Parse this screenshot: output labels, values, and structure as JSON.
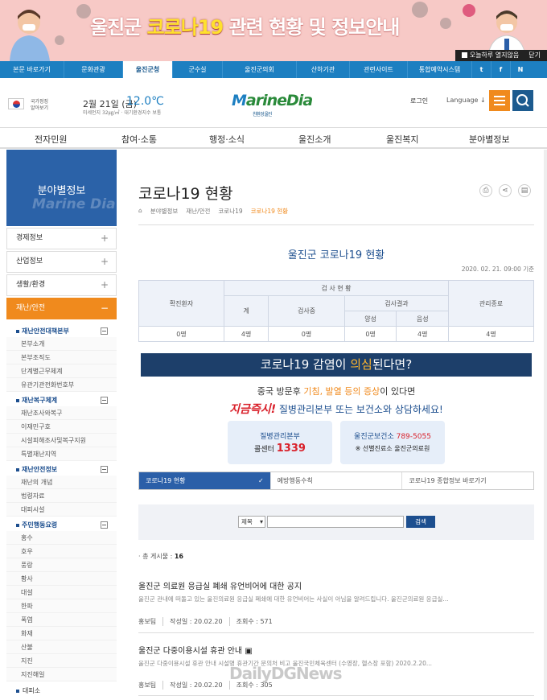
{
  "banner": {
    "title_pre": "울진군 ",
    "title_hl": "코로나19",
    "title_post": " 관련 현황 및 정보안내",
    "close_today": "오늘하루 열지않음",
    "close": "닫기"
  },
  "topnav": {
    "items": [
      "본문 바로가기",
      "문화관광",
      "울진군청",
      "군수실",
      "울진군의회",
      "산하기관",
      "관련사이트",
      "통합예약시스템"
    ],
    "active": "울진군청",
    "icons": [
      "twitter-icon",
      "facebook-icon",
      "naver-icon"
    ]
  },
  "header": {
    "nat_label": "국가정징 알아보기",
    "date": "2월 21일 (금)",
    "temp": "12.0℃",
    "dust": "미세먼지 32㎍/㎥ · 대기환경지수 보통",
    "logo": "MarineDia",
    "logo_sub": "친환경 울진",
    "login": "로그인",
    "language": "Language"
  },
  "gnb": [
    "전자민원",
    "참여·소통",
    "행정·소식",
    "울진소개",
    "울진복지",
    "분야별정보"
  ],
  "sidebar": {
    "title": "분야별정보",
    "watermark": "Marine Dia",
    "menus": [
      "경제정보",
      "산업정보",
      "생활/환경",
      "재난/안전"
    ],
    "groups": [
      {
        "title": "재난안전대책본부",
        "items": [
          "본부소개",
          "본부조직도",
          "단계별근무체계",
          "유관기관전화번호부"
        ]
      },
      {
        "title": "재난복구체계",
        "items": [
          "재난조사와복구",
          "이재민구호",
          "시설피해조사및복구지원",
          "특별재난지역"
        ]
      },
      {
        "title": "재난안전정보",
        "items": [
          "재난의 개념",
          "법령자료",
          "대피시설"
        ]
      },
      {
        "title": "주민행동요령",
        "items": [
          "홍수",
          "호우",
          "풍랑",
          "황사",
          "대설",
          "한파",
          "폭염",
          "화재",
          "산불",
          "지진",
          "지진해일"
        ]
      }
    ],
    "last": "대피소"
  },
  "content": {
    "page_title": "코로나19 현황",
    "breadcrumb": [
      "분야별정보",
      "재난/안전",
      "코로나19",
      "코로나19 현황"
    ],
    "status_title": "울진군 코로나19 현황",
    "status_date": "2020. 02. 21. 09:00 기준",
    "table": {
      "h_confirmed": "확진환자",
      "h_test": "검 사 현 황",
      "h_total": "계",
      "h_testing": "검사중",
      "h_result": "검사결과",
      "h_pos": "양성",
      "h_neg": "음성",
      "h_release": "관리종료",
      "row": [
        "0명",
        "4명",
        "0명",
        "0명",
        "4명",
        "4명"
      ]
    },
    "suspect_pre": "코로나19 감염이 ",
    "suspect_hl": "의심",
    "suspect_post": "된다면?",
    "line1_pre": "중국 방문후 ",
    "line1_hl": "기침, 발열 등의 증상",
    "line1_post": "이 있다면",
    "line2_hl": "지금즉시!",
    "line2_post": " 질병관리본부 또는 보건소와 상담하세요!",
    "card1_a": "질병관리본부",
    "card1_b": "콜센터 ",
    "card1_num": "1339",
    "card2_a": "울진군보건소 ",
    "card2_num": "789-5055",
    "card2_b": "※ 선별진료소 울진군의료원",
    "tabs": [
      "코로나19 현황",
      "예방행동수칙",
      "코로나19 종합정보 바로가기"
    ],
    "search_select": "제목",
    "search_button": "검색",
    "total_label": "· 총 게시물 : ",
    "total": "16",
    "posts": [
      {
        "title": "울진군 의료원 응급실 폐쇄 유언비어에 대한 공지",
        "desc": "울진군 관내에 떠돌고 있는 울진의료원 응급실 폐쇄에 대한 유언비어는 사실이 아님을 알려드립니다. 울진군의료원 응급실...",
        "dept": "홍보팀",
        "date": "작성일 : 20.02.20",
        "views": "조회수 : 571"
      },
      {
        "title": "울진군 다중이용시설 휴관 안내",
        "desc": "울진군 다중이용시설 휴관 안내 시설명 휴관기간 문의처 비고 울진국민체육센터 (수영장, 헬스장 포함) 2020.2.20...",
        "dept": "홍보팀",
        "date": "작성일 : 20.02.20",
        "views": "조회수 : 305"
      }
    ]
  },
  "watermark": "DailyDGNews"
}
